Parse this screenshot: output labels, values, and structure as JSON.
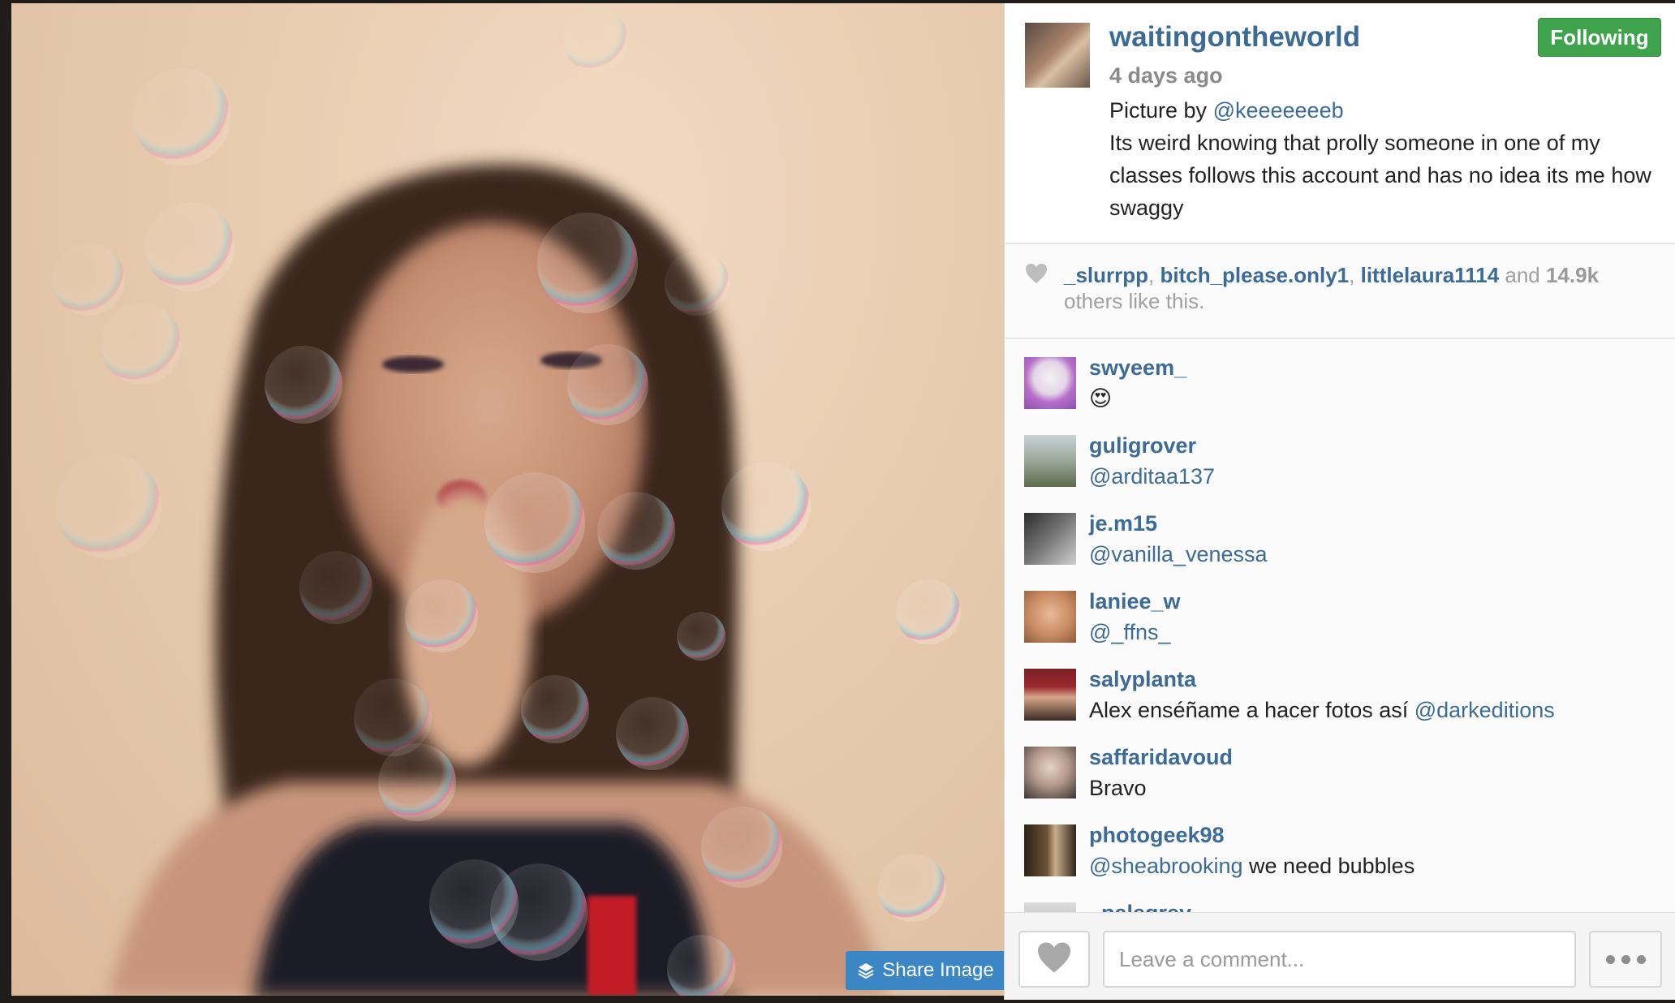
{
  "post": {
    "owner": "waitingontheworld",
    "follow_label": "Following",
    "time": "4 days ago",
    "caption_prefix": "Picture by ",
    "caption_mention": "@keeeeeeeb",
    "caption_text": "Its weird knowing that prolly someone in one of my classes follows this account and has no idea its me how swaggy"
  },
  "photo": {
    "share_label": "Share Image",
    "share_icon": "layers-icon"
  },
  "likes": {
    "users": [
      "_slurrpp",
      "bitch_please.only1",
      "littlelaura1114"
    ],
    "sep1": ", ",
    "sep2": ", ",
    "and": " and ",
    "count": "14.9k",
    "suffix": "others like this."
  },
  "comments": [
    {
      "user": "swyeem_",
      "text": "😍",
      "mention": ""
    },
    {
      "user": "guligrover",
      "text": "",
      "mention": "@arditaa137"
    },
    {
      "user": "je.m15",
      "text": "",
      "mention": "@vanilla_venessa"
    },
    {
      "user": "laniee_w",
      "text": "",
      "mention": "@_ffns_"
    },
    {
      "user": "salyplanta",
      "text": "Alex enséñame a hacer fotos así ",
      "mention": "@darkeditions"
    },
    {
      "user": "saffaridavoud",
      "text": "Bravo",
      "mention": ""
    },
    {
      "user": "photogeek98",
      "text": " we need bubbles",
      "mention": "@sheabrooking"
    },
    {
      "user": "_palegrey",
      "text": "",
      "mention": ""
    }
  ],
  "footer": {
    "comment_placeholder": "Leave a comment..."
  },
  "colors": {
    "link": "#3c6c96",
    "follow_green": "#3fa34d",
    "share_blue": "#3b86c4"
  }
}
